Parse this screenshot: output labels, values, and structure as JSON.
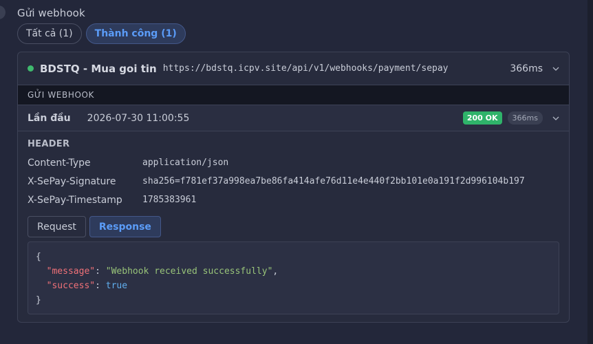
{
  "section_title": "Gửi webhook",
  "filters": [
    {
      "label": "Tất cả (1)"
    },
    {
      "label": "Thành công (1)"
    }
  ],
  "webhook": {
    "status_color": "#3fb96e",
    "app_name": "BDSTQ - Mua goi tin",
    "url": "https://bdstq.icpv.site/api/v1/webhooks/payment/sepay",
    "duration": "366ms"
  },
  "subheader": "GỬI WEBHOOK",
  "attempt": {
    "label": "Lần đầu",
    "datetime": "2026-07-30 11:00:55",
    "status_badge": "200 OK",
    "duration_badge": "366ms"
  },
  "headers_section": {
    "title": "HEADER",
    "rows": [
      {
        "key": "Content-Type",
        "value": "application/json"
      },
      {
        "key": "X-SePay-Signature",
        "value": "sha256=f781ef37a998ea7be86fa414afe76d11e4e440f2bb101e0a191f2d996104b197"
      },
      {
        "key": "X-SePay-Timestamp",
        "value": "1785383961"
      }
    ]
  },
  "payload_tabs": {
    "request": "Request",
    "response": "Response",
    "active": "Response"
  },
  "response_body": {
    "open": "{",
    "message_key": "\"message\"",
    "message_value": "\"Webhook received successfully\"",
    "success_key": "\"success\"",
    "success_value": "true",
    "close": "}"
  }
}
